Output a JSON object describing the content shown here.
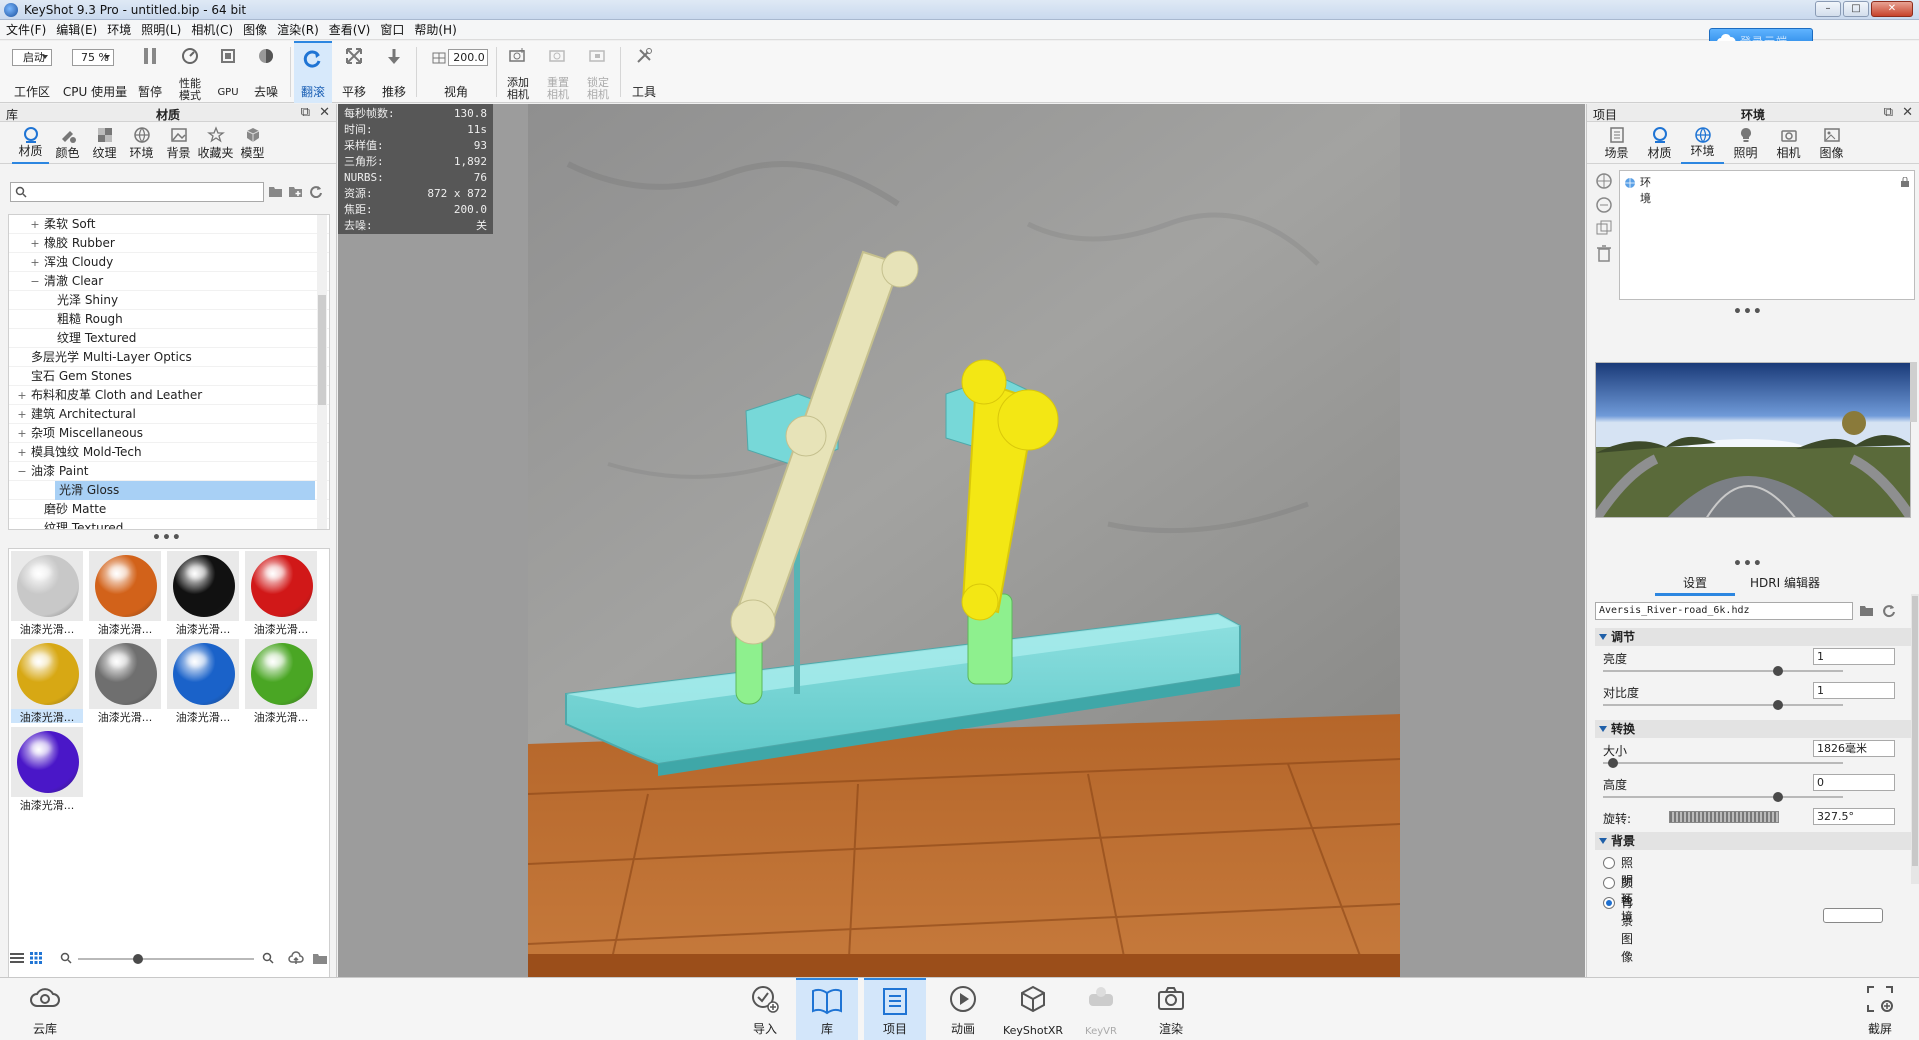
{
  "window": {
    "title": "KeyShot 9.3 Pro  - untitled.bip  - 64 bit",
    "min": "–",
    "max": "□",
    "close": "✕"
  },
  "menu": [
    "文件(F)",
    "编辑(E)",
    "环境",
    "照明(L)",
    "相机(C)",
    "图像",
    "渲染(R)",
    "查看(V)",
    "窗口",
    "帮助(H)"
  ],
  "cloud_button": {
    "label": "登录云端"
  },
  "toolbar": {
    "workspace_select": "启动",
    "workspace_label": "工作区",
    "cpu_select": "75 %",
    "cpu_label": "CPU 使用量",
    "pause_label": "暂停",
    "perf_label": "性能\n模式",
    "gpu_label": "GPU",
    "denoise_label": "去噪",
    "tumble_label": "翻滚",
    "pan_label": "平移",
    "dolly_label": "推移",
    "fov_value": "200.0",
    "fov_label": "视角",
    "add_camera_label": "添加\n相机",
    "reset_camera_label": "重置\n相机",
    "lock_camera_label": "锁定\n相机",
    "tools_label": "工具"
  },
  "library": {
    "panel_left_title": "库",
    "panel_title": "材质",
    "tabs": [
      {
        "label": "材质",
        "icon": "material-icon",
        "active": true
      },
      {
        "label": "颜色",
        "icon": "color-icon"
      },
      {
        "label": "纹理",
        "icon": "texture-icon"
      },
      {
        "label": "环境",
        "icon": "environment-icon"
      },
      {
        "label": "背景",
        "icon": "background-icon"
      },
      {
        "label": "收藏夹",
        "icon": "favorites-icon"
      },
      {
        "label": "模型",
        "icon": "model-icon"
      }
    ],
    "search_placeholder": "",
    "tree": [
      {
        "label": "柔软 Soft",
        "level": 2,
        "exp": "+"
      },
      {
        "label": "橡胶 Rubber",
        "level": 2,
        "exp": "+"
      },
      {
        "label": "浑浊 Cloudy",
        "level": 2,
        "exp": "+"
      },
      {
        "label": "清澈 Clear",
        "level": 2,
        "exp": "−"
      },
      {
        "label": "光泽 Shiny",
        "level": 3,
        "exp": ""
      },
      {
        "label": "粗糙 Rough",
        "level": 3,
        "exp": ""
      },
      {
        "label": "纹理 Textured",
        "level": 3,
        "exp": ""
      },
      {
        "label": "多层光学 Multi-Layer Optics",
        "level": 1,
        "exp": ""
      },
      {
        "label": "宝石 Gem Stones",
        "level": 1,
        "exp": ""
      },
      {
        "label": "布料和皮革 Cloth and Leather",
        "level": 1,
        "exp": "+"
      },
      {
        "label": "建筑 Architectural",
        "level": 1,
        "exp": "+"
      },
      {
        "label": "杂项 Miscellaneous",
        "level": 1,
        "exp": "+"
      },
      {
        "label": "模具蚀纹 Mold-Tech",
        "level": 1,
        "exp": "+"
      },
      {
        "label": "油漆 Paint",
        "level": 1,
        "exp": "−"
      },
      {
        "label": "光滑 Gloss",
        "level": 2,
        "exp": "",
        "selected": true
      },
      {
        "label": "磨砂 Matte",
        "level": 2,
        "exp": ""
      },
      {
        "label": "纹理 Textured",
        "level": 2,
        "exp": ""
      }
    ],
    "thumbnails": [
      {
        "label": "油漆光滑...",
        "color": "#c8c8c8"
      },
      {
        "label": "油漆光滑...",
        "color": "#d2621a"
      },
      {
        "label": "油漆光滑...",
        "color": "#111111"
      },
      {
        "label": "油漆光滑...",
        "color": "#d11818"
      },
      {
        "label": "油漆光滑...",
        "color": "#d7a814",
        "selected": true
      },
      {
        "label": "油漆光滑...",
        "color": "#6f6f6f"
      },
      {
        "label": "油漆光滑...",
        "color": "#1a62c9"
      },
      {
        "label": "油漆光滑...",
        "color": "#4aa624"
      },
      {
        "label": "油漆光滑...",
        "color": "#4a17c8"
      }
    ]
  },
  "stats": [
    {
      "k": "每秒帧数:",
      "v": "130.8"
    },
    {
      "k": "时间:",
      "v": "11s"
    },
    {
      "k": "采样值:",
      "v": "93"
    },
    {
      "k": "三角形:",
      "v": "1,892"
    },
    {
      "k": "NURBS:",
      "v": "76"
    },
    {
      "k": "资源:",
      "v": "872 x 872"
    },
    {
      "k": "焦距:",
      "v": "200.0"
    },
    {
      "k": "去噪:",
      "v": "关"
    }
  ],
  "project": {
    "panel_left_title": "项目",
    "panel_title": "环境",
    "tabs": [
      {
        "label": "场景",
        "icon": "scene-icon"
      },
      {
        "label": "材质",
        "icon": "material-icon"
      },
      {
        "label": "环境",
        "icon": "environment-icon",
        "active": true
      },
      {
        "label": "照明",
        "icon": "lighting-icon"
      },
      {
        "label": "相机",
        "icon": "camera-icon"
      },
      {
        "label": "图像",
        "icon": "image-icon"
      }
    ],
    "env_item": "环境",
    "subtabs": {
      "settings": "设置",
      "hdri_editor": "HDRI 编辑器"
    },
    "hdri_file": "Aversis_River-road_6k.hdz",
    "adjust": {
      "title": "调节",
      "brightness_label": "亮度",
      "brightness_value": "1",
      "brightness_level": 0.74,
      "contrast_label": "对比度",
      "contrast_value": "1",
      "contrast_level": 0.74
    },
    "transform": {
      "title": "转换",
      "size_label": "大小",
      "size_value": "1826毫米",
      "size_level": 0.02,
      "height_label": "高度",
      "height_value": "0",
      "height_level": 0.74,
      "rotation_label": "旋转:",
      "rotation_value": "327.5°"
    },
    "background": {
      "title": "背景",
      "options": [
        {
          "label": "照明环境",
          "selected": false
        },
        {
          "label": "颜色",
          "selected": false
        },
        {
          "label": "背景图像",
          "selected": true
        }
      ],
      "color": "#ffffff"
    }
  },
  "bottombar": {
    "cloud_library": "云库",
    "import": "导入",
    "library": "库",
    "project": "项目",
    "animation": "动画",
    "keyshotxr": "KeyShotXR",
    "keyvr": "KeyVR",
    "render": "渲染",
    "screenshot": "截屏"
  },
  "colors": {
    "accent": "#2c86e0",
    "selection": "#a8d0f5"
  }
}
